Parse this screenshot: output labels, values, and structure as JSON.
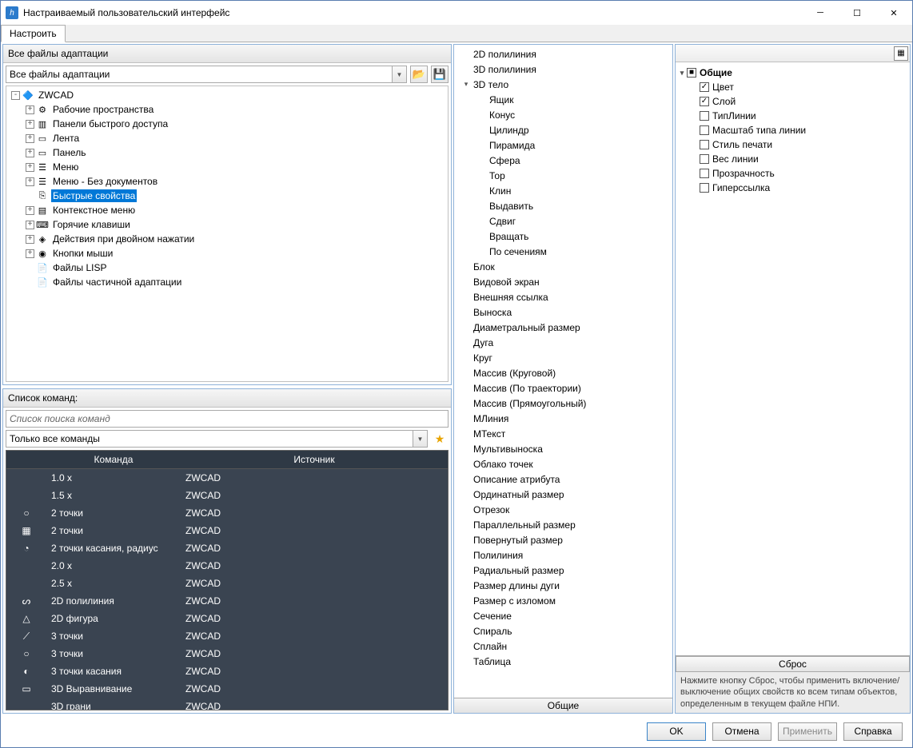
{
  "window": {
    "title": "Настраиваемый пользовательский интерфейс"
  },
  "tabs": [
    "Настроить"
  ],
  "left": {
    "adapt": {
      "heading": "Все файлы адаптации",
      "combo": "Все файлы адаптации",
      "tree": [
        {
          "depth": 0,
          "exp": "-",
          "icon": "🔷",
          "label": "ZWCAD"
        },
        {
          "depth": 1,
          "exp": "+",
          "icon": "⚙",
          "label": "Рабочие пространства"
        },
        {
          "depth": 1,
          "exp": "+",
          "icon": "▥",
          "label": "Панели быстрого доступа"
        },
        {
          "depth": 1,
          "exp": "+",
          "icon": "▭",
          "label": "Лента"
        },
        {
          "depth": 1,
          "exp": "+",
          "icon": "▭",
          "label": "Панель"
        },
        {
          "depth": 1,
          "exp": "+",
          "icon": "☰",
          "label": "Меню"
        },
        {
          "depth": 1,
          "exp": "+",
          "icon": "☰",
          "label": "Меню - Без документов"
        },
        {
          "depth": 1,
          "exp": "",
          "icon": "⎘",
          "label": "Быстрые свойства",
          "selected": true
        },
        {
          "depth": 1,
          "exp": "+",
          "icon": "▤",
          "label": "Контекстное меню"
        },
        {
          "depth": 1,
          "exp": "+",
          "icon": "⌨",
          "label": "Горячие клавиши"
        },
        {
          "depth": 1,
          "exp": "+",
          "icon": "◈",
          "label": "Действия при двойном нажатии"
        },
        {
          "depth": 1,
          "exp": "+",
          "icon": "◉",
          "label": "Кнопки мыши"
        },
        {
          "depth": 1,
          "exp": "",
          "icon": "📄",
          "label": "Файлы LISP"
        },
        {
          "depth": 1,
          "exp": "",
          "icon": "📄",
          "label": "Файлы частичной адаптации"
        }
      ]
    },
    "commands": {
      "heading": "Список команд:",
      "search_placeholder": "Список поиска команд",
      "filter": "Только все команды",
      "columns": [
        "Команда",
        "Источник"
      ],
      "rows": [
        {
          "icon": "",
          "name": "1.0 x",
          "src": "ZWCAD"
        },
        {
          "icon": "",
          "name": "1.5 x",
          "src": "ZWCAD"
        },
        {
          "icon": "○",
          "name": "2 точки",
          "src": "ZWCAD"
        },
        {
          "icon": "▦",
          "name": "2 точки",
          "src": "ZWCAD"
        },
        {
          "icon": "◔",
          "name": "2 точки касания, радиус",
          "src": "ZWCAD"
        },
        {
          "icon": "",
          "name": "2.0 x",
          "src": "ZWCAD"
        },
        {
          "icon": "",
          "name": "2.5 x",
          "src": "ZWCAD"
        },
        {
          "icon": "ᔕ",
          "name": "2D полилиния",
          "src": "ZWCAD"
        },
        {
          "icon": "△",
          "name": "2D фигура",
          "src": "ZWCAD"
        },
        {
          "icon": "⟋",
          "name": "3 точки",
          "src": "ZWCAD"
        },
        {
          "icon": "○",
          "name": "3 точки",
          "src": "ZWCAD"
        },
        {
          "icon": "◐",
          "name": "3 точки касания",
          "src": "ZWCAD"
        },
        {
          "icon": "▭",
          "name": "3D Выравнивание",
          "src": "ZWCAD"
        },
        {
          "icon": "",
          "name": "3D грани",
          "src": "ZWCAD"
        }
      ]
    }
  },
  "middle": {
    "footer_tab": "Общие",
    "items": [
      {
        "depth": 0,
        "caret": "",
        "label": "2D полилиния"
      },
      {
        "depth": 0,
        "caret": "",
        "label": "3D полилиния"
      },
      {
        "depth": 0,
        "caret": "▾",
        "label": "3D тело"
      },
      {
        "depth": 1,
        "caret": "",
        "label": "Ящик"
      },
      {
        "depth": 1,
        "caret": "",
        "label": "Конус"
      },
      {
        "depth": 1,
        "caret": "",
        "label": "Цилиндр"
      },
      {
        "depth": 1,
        "caret": "",
        "label": "Пирамида"
      },
      {
        "depth": 1,
        "caret": "",
        "label": "Сфера"
      },
      {
        "depth": 1,
        "caret": "",
        "label": "Тор"
      },
      {
        "depth": 1,
        "caret": "",
        "label": "Клин"
      },
      {
        "depth": 1,
        "caret": "",
        "label": "Выдавить"
      },
      {
        "depth": 1,
        "caret": "",
        "label": "Сдвиг"
      },
      {
        "depth": 1,
        "caret": "",
        "label": "Вращать"
      },
      {
        "depth": 1,
        "caret": "",
        "label": "По сечениям"
      },
      {
        "depth": 0,
        "caret": "",
        "label": "Блок"
      },
      {
        "depth": 0,
        "caret": "",
        "label": "Видовой экран"
      },
      {
        "depth": 0,
        "caret": "",
        "label": "Внешняя ссылка"
      },
      {
        "depth": 0,
        "caret": "",
        "label": "Выноска"
      },
      {
        "depth": 0,
        "caret": "",
        "label": "Диаметральный размер"
      },
      {
        "depth": 0,
        "caret": "",
        "label": "Дуга"
      },
      {
        "depth": 0,
        "caret": "",
        "label": "Круг"
      },
      {
        "depth": 0,
        "caret": "",
        "label": "Массив (Круговой)"
      },
      {
        "depth": 0,
        "caret": "",
        "label": "Массив (По траектории)"
      },
      {
        "depth": 0,
        "caret": "",
        "label": "Массив (Прямоугольный)"
      },
      {
        "depth": 0,
        "caret": "",
        "label": "МЛиния"
      },
      {
        "depth": 0,
        "caret": "",
        "label": "МТекст"
      },
      {
        "depth": 0,
        "caret": "",
        "label": "Мультивыноска"
      },
      {
        "depth": 0,
        "caret": "",
        "label": "Облако точек"
      },
      {
        "depth": 0,
        "caret": "",
        "label": "Описание атрибута"
      },
      {
        "depth": 0,
        "caret": "",
        "label": "Ординатный размер"
      },
      {
        "depth": 0,
        "caret": "",
        "label": "Отрезок"
      },
      {
        "depth": 0,
        "caret": "",
        "label": "Параллельный размер"
      },
      {
        "depth": 0,
        "caret": "",
        "label": "Повернутый размер"
      },
      {
        "depth": 0,
        "caret": "",
        "label": "Полилиния"
      },
      {
        "depth": 0,
        "caret": "",
        "label": "Радиальный размер"
      },
      {
        "depth": 0,
        "caret": "",
        "label": "Размер длины дуги"
      },
      {
        "depth": 0,
        "caret": "",
        "label": "Размер с изломом"
      },
      {
        "depth": 0,
        "caret": "",
        "label": "Сечение"
      },
      {
        "depth": 0,
        "caret": "",
        "label": "Спираль"
      },
      {
        "depth": 0,
        "caret": "",
        "label": "Сплайн"
      },
      {
        "depth": 0,
        "caret": "",
        "label": "Таблица"
      }
    ]
  },
  "right": {
    "group": "Общие",
    "props": [
      {
        "label": "Цвет",
        "checked": true
      },
      {
        "label": "Слой",
        "checked": true
      },
      {
        "label": "ТипЛинии",
        "checked": false
      },
      {
        "label": "Масштаб типа линии",
        "checked": false
      },
      {
        "label": "Стиль печати",
        "checked": false
      },
      {
        "label": "Вес линии",
        "checked": false
      },
      {
        "label": "Прозрачность",
        "checked": false
      },
      {
        "label": "Гиперссылка",
        "checked": false
      }
    ],
    "reset_label": "Сброс",
    "hint": "Нажмите кнопку Сброс, чтобы применить включение/выключение общих свойств ко всем типам объектов, определенным в текущем файле НПИ."
  },
  "footer": {
    "ok": "OK",
    "cancel": "Отмена",
    "apply": "Применить",
    "help": "Справка"
  }
}
